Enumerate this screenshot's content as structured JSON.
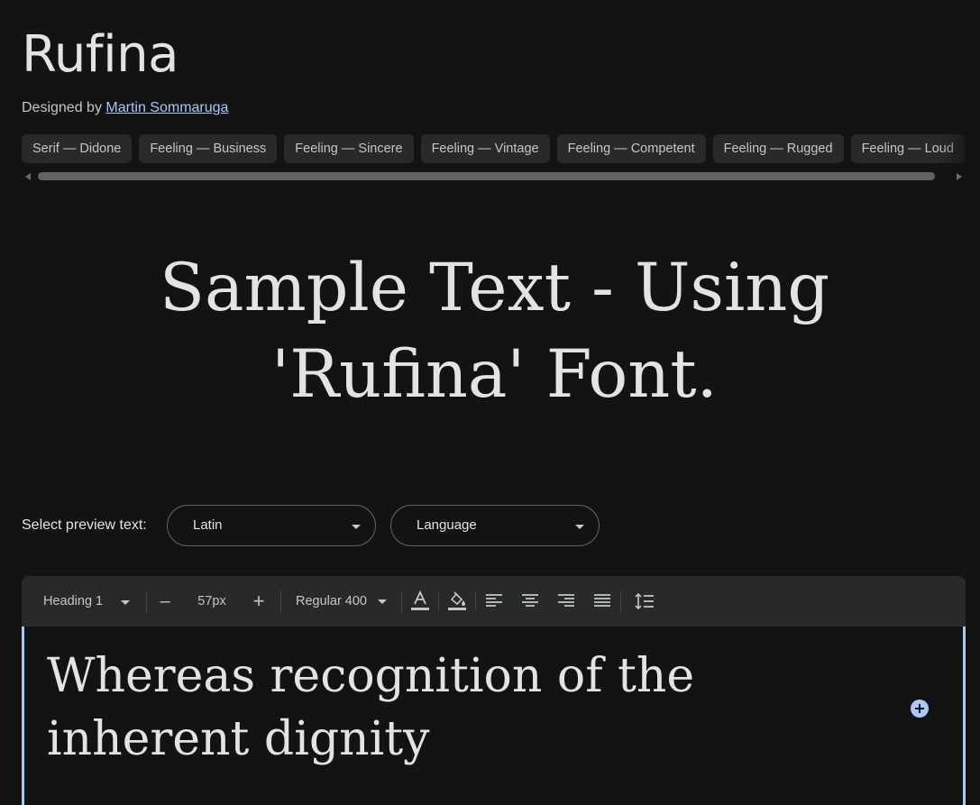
{
  "header": {
    "title": "Rufina",
    "designed_by_prefix": "Designed by",
    "designer": "Martin Sommaruga"
  },
  "tags": [
    "Serif — Didone",
    "Feeling — Business",
    "Feeling — Sincere",
    "Feeling — Vintage",
    "Feeling — Competent",
    "Feeling — Rugged",
    "Feeling — Loud"
  ],
  "sample": {
    "line1": "Sample Text - Using",
    "line2": "'Rufina' Font."
  },
  "preview": {
    "label": "Select preview text:",
    "script_value": "Latin",
    "language_value": "Language"
  },
  "toolbar": {
    "style": "Heading 1",
    "decrease": "–",
    "size": "57px",
    "increase": "+",
    "weight": "Regular 400"
  },
  "editor": {
    "line1": "Whereas recognition of the",
    "line2": "inherent dignity"
  },
  "colors": {
    "background": "#131314",
    "accent": "#a8c7fa",
    "chip": "#28292a"
  }
}
